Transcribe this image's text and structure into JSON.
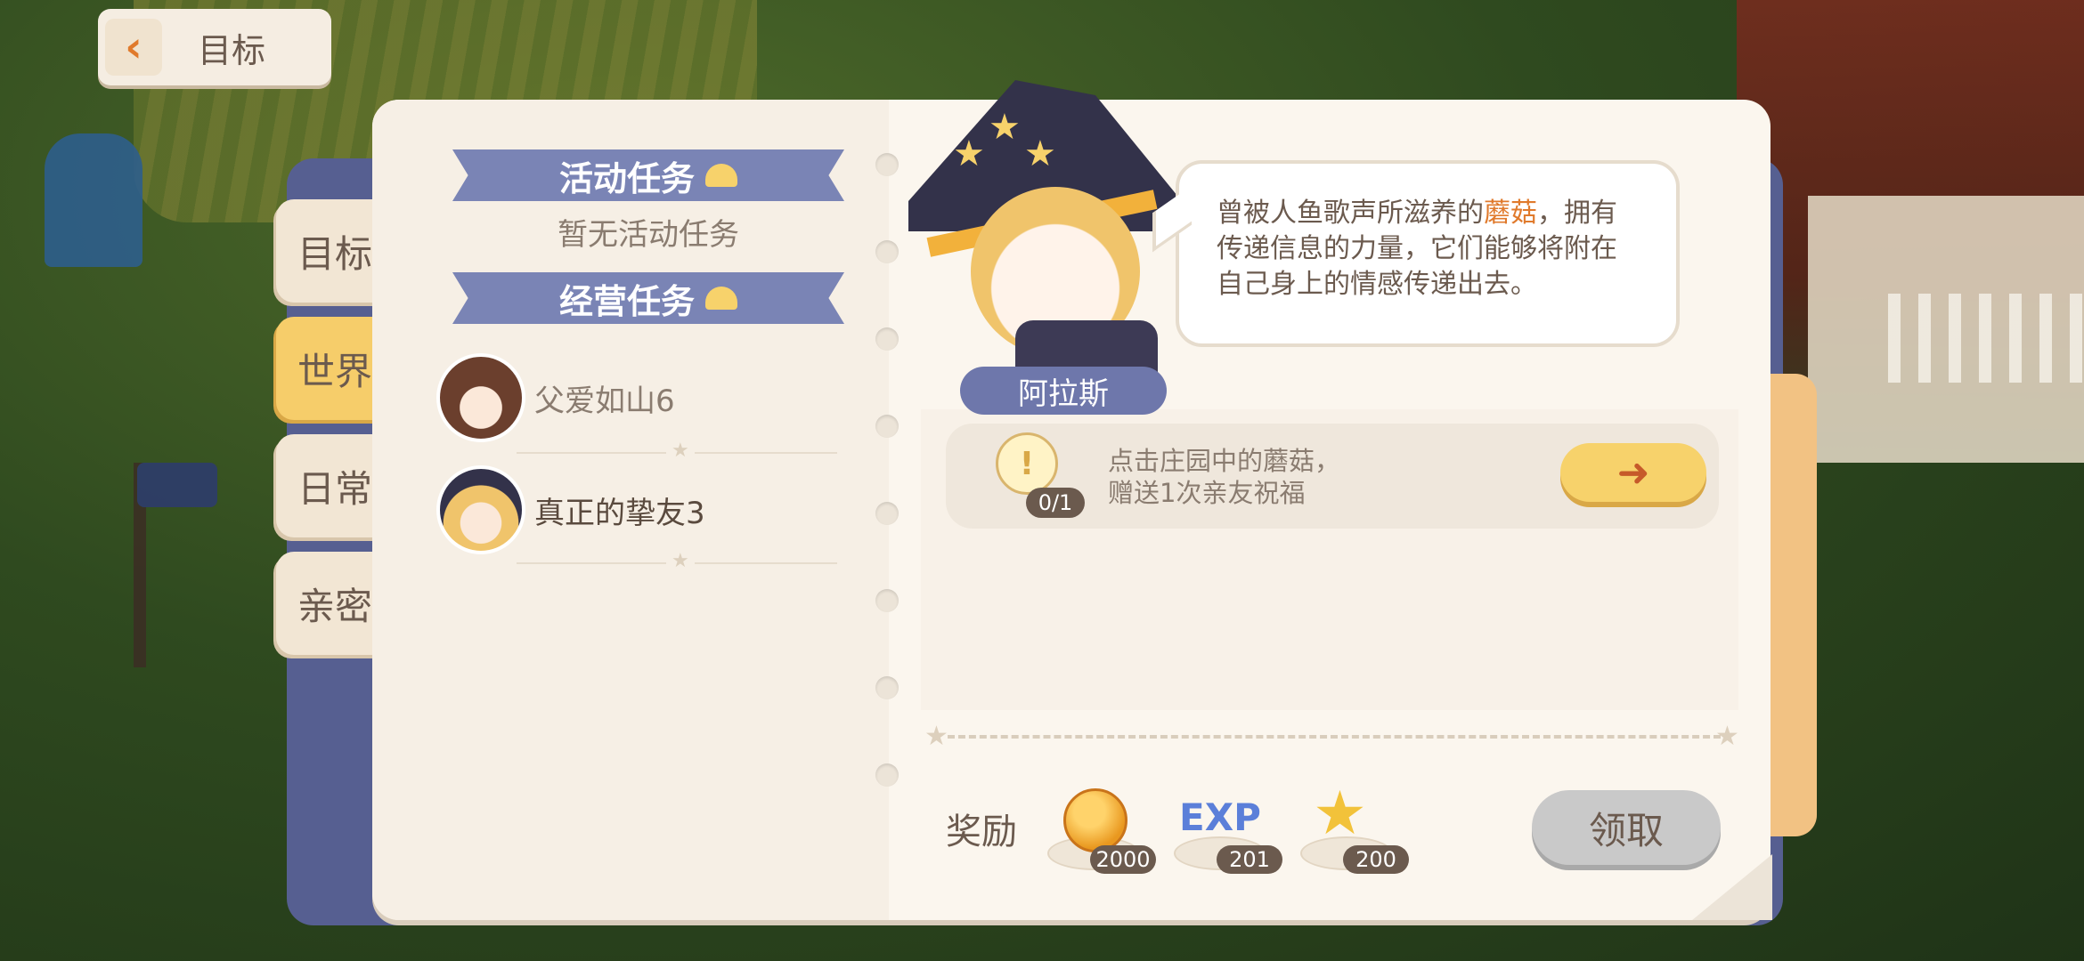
{
  "header": {
    "back_label": "目标"
  },
  "side_tabs": [
    {
      "label": "目标",
      "active": false
    },
    {
      "label": "世界",
      "active": true
    },
    {
      "label": "日常",
      "active": false
    },
    {
      "label": "亲密",
      "active": false
    }
  ],
  "left_page": {
    "activity_title": "活动任务",
    "activity_empty": "暂无活动任务",
    "business_title": "经营任务",
    "tasks": [
      {
        "name": "父爱如山6",
        "avatar": "brown-hair-boy-avatar",
        "selected": false
      },
      {
        "name": "真正的挚友3",
        "avatar": "witch-girl-avatar",
        "selected": true
      }
    ]
  },
  "right_page": {
    "character_name": "阿拉斯",
    "speech_before": "曾被人鱼歌声所滋养的",
    "speech_highlight": "蘑菇",
    "speech_after": "，拥有传递信息的力量，它们能够将附在自己身上的情感传递出去。",
    "objective": {
      "line1": "点击庄园中的蘑菇，",
      "line2": "赠送1次亲友祝福",
      "progress": "0/1",
      "go_icon": "arrow-right-icon"
    },
    "rewards_label": "奖励",
    "rewards": [
      {
        "icon": "coin-icon",
        "count": "2000"
      },
      {
        "icon": "exp-icon",
        "label": "EXP",
        "count": "201"
      },
      {
        "icon": "star-icon",
        "count": "200"
      }
    ],
    "claim_label": "领取"
  },
  "colors": {
    "accent_yellow": "#f7d26b",
    "ribbon_blue": "#7a84b5",
    "highlight_orange": "#e07a2c",
    "claim_disabled": "#c9c9c9"
  }
}
